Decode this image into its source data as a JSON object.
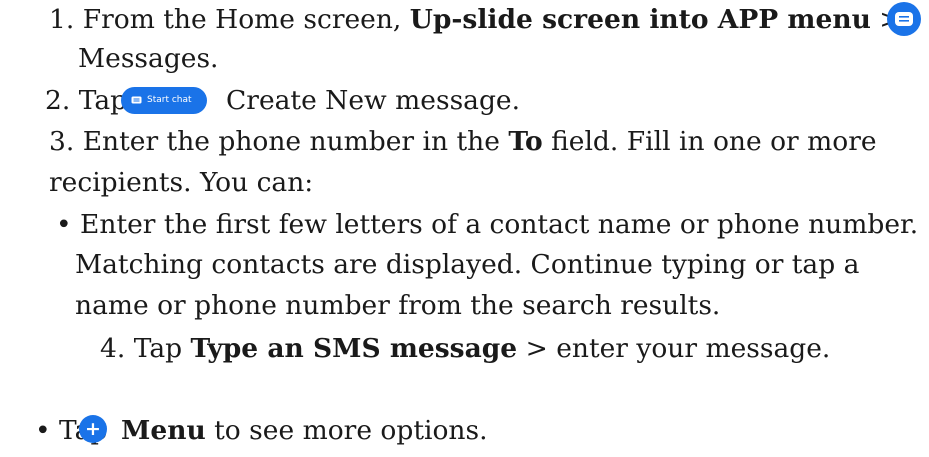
{
  "steps": {
    "s1": {
      "prefix": "1. From the Home screen, ",
      "bold": "Up-slide screen into APP menu",
      "suffix": " >",
      "cont": "Messages."
    },
    "s2": {
      "prefix": "2. Tap",
      "button_label": "Start chat",
      "suffix": "Create New message."
    },
    "s3": {
      "prefix": "3. Enter the phone number in the ",
      "bold": "To",
      "suffix": " field. Fill in one or more",
      "cont": "recipients. You can:"
    },
    "bullet1": {
      "line1": "• Enter the first few letters of a contact name or phone number.",
      "line2": "Matching contacts are displayed. Continue typing or tap a",
      "line3": "name or phone number from the search results."
    },
    "s4": {
      "prefix": "4. Tap ",
      "bold": "Type an SMS message",
      "suffix": " > enter your message."
    },
    "bullet2": {
      "prefix": "• Tap",
      "bold": "Menu",
      "suffix": " to see more options."
    }
  },
  "icons": {
    "messages": "messages-app-icon",
    "start_chat": "start-chat-button-icon",
    "menu": "plus-icon"
  },
  "colors": {
    "accent": "#1a73e8",
    "text": "#1a1a1a"
  }
}
